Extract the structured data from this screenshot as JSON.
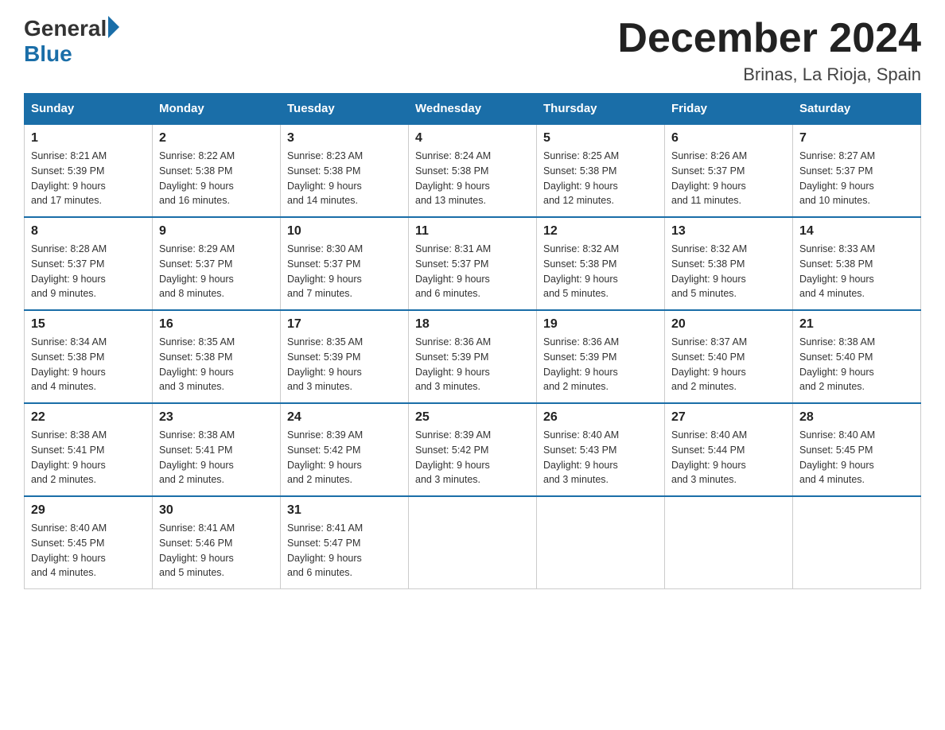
{
  "header": {
    "logo_general": "General",
    "logo_blue": "Blue",
    "month_title": "December 2024",
    "location": "Brinas, La Rioja, Spain"
  },
  "columns": [
    "Sunday",
    "Monday",
    "Tuesday",
    "Wednesday",
    "Thursday",
    "Friday",
    "Saturday"
  ],
  "weeks": [
    [
      {
        "day": "1",
        "sunrise": "8:21 AM",
        "sunset": "5:39 PM",
        "daylight": "9 hours and 17 minutes."
      },
      {
        "day": "2",
        "sunrise": "8:22 AM",
        "sunset": "5:38 PM",
        "daylight": "9 hours and 16 minutes."
      },
      {
        "day": "3",
        "sunrise": "8:23 AM",
        "sunset": "5:38 PM",
        "daylight": "9 hours and 14 minutes."
      },
      {
        "day": "4",
        "sunrise": "8:24 AM",
        "sunset": "5:38 PM",
        "daylight": "9 hours and 13 minutes."
      },
      {
        "day": "5",
        "sunrise": "8:25 AM",
        "sunset": "5:38 PM",
        "daylight": "9 hours and 12 minutes."
      },
      {
        "day": "6",
        "sunrise": "8:26 AM",
        "sunset": "5:37 PM",
        "daylight": "9 hours and 11 minutes."
      },
      {
        "day": "7",
        "sunrise": "8:27 AM",
        "sunset": "5:37 PM",
        "daylight": "9 hours and 10 minutes."
      }
    ],
    [
      {
        "day": "8",
        "sunrise": "8:28 AM",
        "sunset": "5:37 PM",
        "daylight": "9 hours and 9 minutes."
      },
      {
        "day": "9",
        "sunrise": "8:29 AM",
        "sunset": "5:37 PM",
        "daylight": "9 hours and 8 minutes."
      },
      {
        "day": "10",
        "sunrise": "8:30 AM",
        "sunset": "5:37 PM",
        "daylight": "9 hours and 7 minutes."
      },
      {
        "day": "11",
        "sunrise": "8:31 AM",
        "sunset": "5:37 PM",
        "daylight": "9 hours and 6 minutes."
      },
      {
        "day": "12",
        "sunrise": "8:32 AM",
        "sunset": "5:38 PM",
        "daylight": "9 hours and 5 minutes."
      },
      {
        "day": "13",
        "sunrise": "8:32 AM",
        "sunset": "5:38 PM",
        "daylight": "9 hours and 5 minutes."
      },
      {
        "day": "14",
        "sunrise": "8:33 AM",
        "sunset": "5:38 PM",
        "daylight": "9 hours and 4 minutes."
      }
    ],
    [
      {
        "day": "15",
        "sunrise": "8:34 AM",
        "sunset": "5:38 PM",
        "daylight": "9 hours and 4 minutes."
      },
      {
        "day": "16",
        "sunrise": "8:35 AM",
        "sunset": "5:38 PM",
        "daylight": "9 hours and 3 minutes."
      },
      {
        "day": "17",
        "sunrise": "8:35 AM",
        "sunset": "5:39 PM",
        "daylight": "9 hours and 3 minutes."
      },
      {
        "day": "18",
        "sunrise": "8:36 AM",
        "sunset": "5:39 PM",
        "daylight": "9 hours and 3 minutes."
      },
      {
        "day": "19",
        "sunrise": "8:36 AM",
        "sunset": "5:39 PM",
        "daylight": "9 hours and 2 minutes."
      },
      {
        "day": "20",
        "sunrise": "8:37 AM",
        "sunset": "5:40 PM",
        "daylight": "9 hours and 2 minutes."
      },
      {
        "day": "21",
        "sunrise": "8:38 AM",
        "sunset": "5:40 PM",
        "daylight": "9 hours and 2 minutes."
      }
    ],
    [
      {
        "day": "22",
        "sunrise": "8:38 AM",
        "sunset": "5:41 PM",
        "daylight": "9 hours and 2 minutes."
      },
      {
        "day": "23",
        "sunrise": "8:38 AM",
        "sunset": "5:41 PM",
        "daylight": "9 hours and 2 minutes."
      },
      {
        "day": "24",
        "sunrise": "8:39 AM",
        "sunset": "5:42 PM",
        "daylight": "9 hours and 2 minutes."
      },
      {
        "day": "25",
        "sunrise": "8:39 AM",
        "sunset": "5:42 PM",
        "daylight": "9 hours and 3 minutes."
      },
      {
        "day": "26",
        "sunrise": "8:40 AM",
        "sunset": "5:43 PM",
        "daylight": "9 hours and 3 minutes."
      },
      {
        "day": "27",
        "sunrise": "8:40 AM",
        "sunset": "5:44 PM",
        "daylight": "9 hours and 3 minutes."
      },
      {
        "day": "28",
        "sunrise": "8:40 AM",
        "sunset": "5:45 PM",
        "daylight": "9 hours and 4 minutes."
      }
    ],
    [
      {
        "day": "29",
        "sunrise": "8:40 AM",
        "sunset": "5:45 PM",
        "daylight": "9 hours and 4 minutes."
      },
      {
        "day": "30",
        "sunrise": "8:41 AM",
        "sunset": "5:46 PM",
        "daylight": "9 hours and 5 minutes."
      },
      {
        "day": "31",
        "sunrise": "8:41 AM",
        "sunset": "5:47 PM",
        "daylight": "9 hours and 6 minutes."
      },
      null,
      null,
      null,
      null
    ]
  ],
  "labels": {
    "sunrise": "Sunrise:",
    "sunset": "Sunset:",
    "daylight": "Daylight:"
  }
}
